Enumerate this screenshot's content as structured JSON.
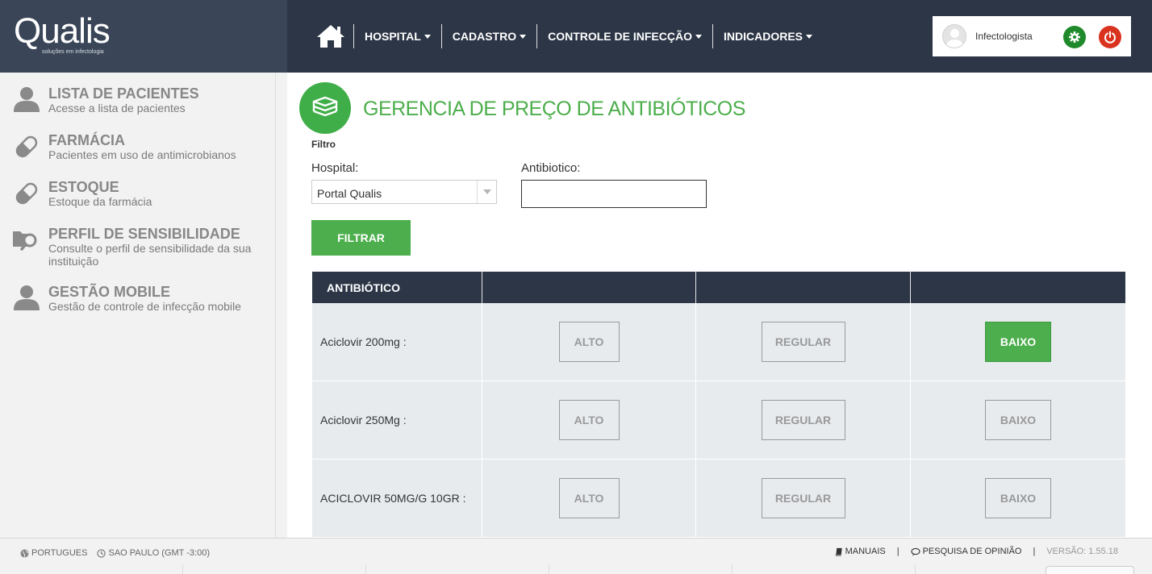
{
  "app": {
    "logo": "Qualis",
    "logo_tagline": "soluções em infectologia"
  },
  "nav": {
    "items": [
      {
        "label": "HOSPITAL"
      },
      {
        "label": "CADASTRO"
      },
      {
        "label": "CONTROLE DE INFECÇÃO"
      },
      {
        "label": "INDICADORES"
      }
    ]
  },
  "user": {
    "name": "Infectologista"
  },
  "sidebar": {
    "items": [
      {
        "title": "LISTA DE PACIENTES",
        "desc": "Acesse a lista de pacientes",
        "icon": "user-icon"
      },
      {
        "title": "FARMÁCIA",
        "desc": "Pacientes em uso de antimicrobianos",
        "icon": "pill-icon"
      },
      {
        "title": "ESTOQUE",
        "desc": "Estoque da farmácia",
        "icon": "pill-icon"
      },
      {
        "title": "PERFIL DE SENSIBILIDADE",
        "desc": "Consulte o perfil de sensibilidade da sua instituição",
        "icon": "folder-search-icon"
      },
      {
        "title": "GESTÃO MOBILE",
        "desc": "Gestão de controle de infecção mobile",
        "icon": "user-icon"
      }
    ]
  },
  "page": {
    "title": "GERENCIA DE PREÇO DE ANTIBIÓTICOS",
    "filter_label": "Filtro",
    "hospital_label": "Hospital:",
    "hospital_value": "Portal Qualis",
    "antibiotic_label": "Antibiotico:",
    "antibiotic_value": "",
    "filter_button": "FILTRAR"
  },
  "table": {
    "headers": [
      "ANTIBIÓTICO",
      "",
      "",
      ""
    ],
    "option_labels": [
      "ALTO",
      "REGULAR",
      "BAIXO"
    ],
    "rows": [
      {
        "name": "Aciclovir 200mg :",
        "selected": "BAIXO"
      },
      {
        "name": "Aciclovir 250Mg :",
        "selected": ""
      },
      {
        "name": "ACICLOVIR 50MG/G 10GR :",
        "selected": ""
      }
    ],
    "colors": {
      "active": "#4cae4c",
      "header": "#2c3646"
    }
  },
  "footer": {
    "language": "PORTUGUES",
    "timezone": "SAO PAULO (GMT -3:00)",
    "manuals": "MANUAIS",
    "survey": "PESQUISA DE OPINIÃO",
    "version": "VERSÃO: 1.55.18"
  }
}
